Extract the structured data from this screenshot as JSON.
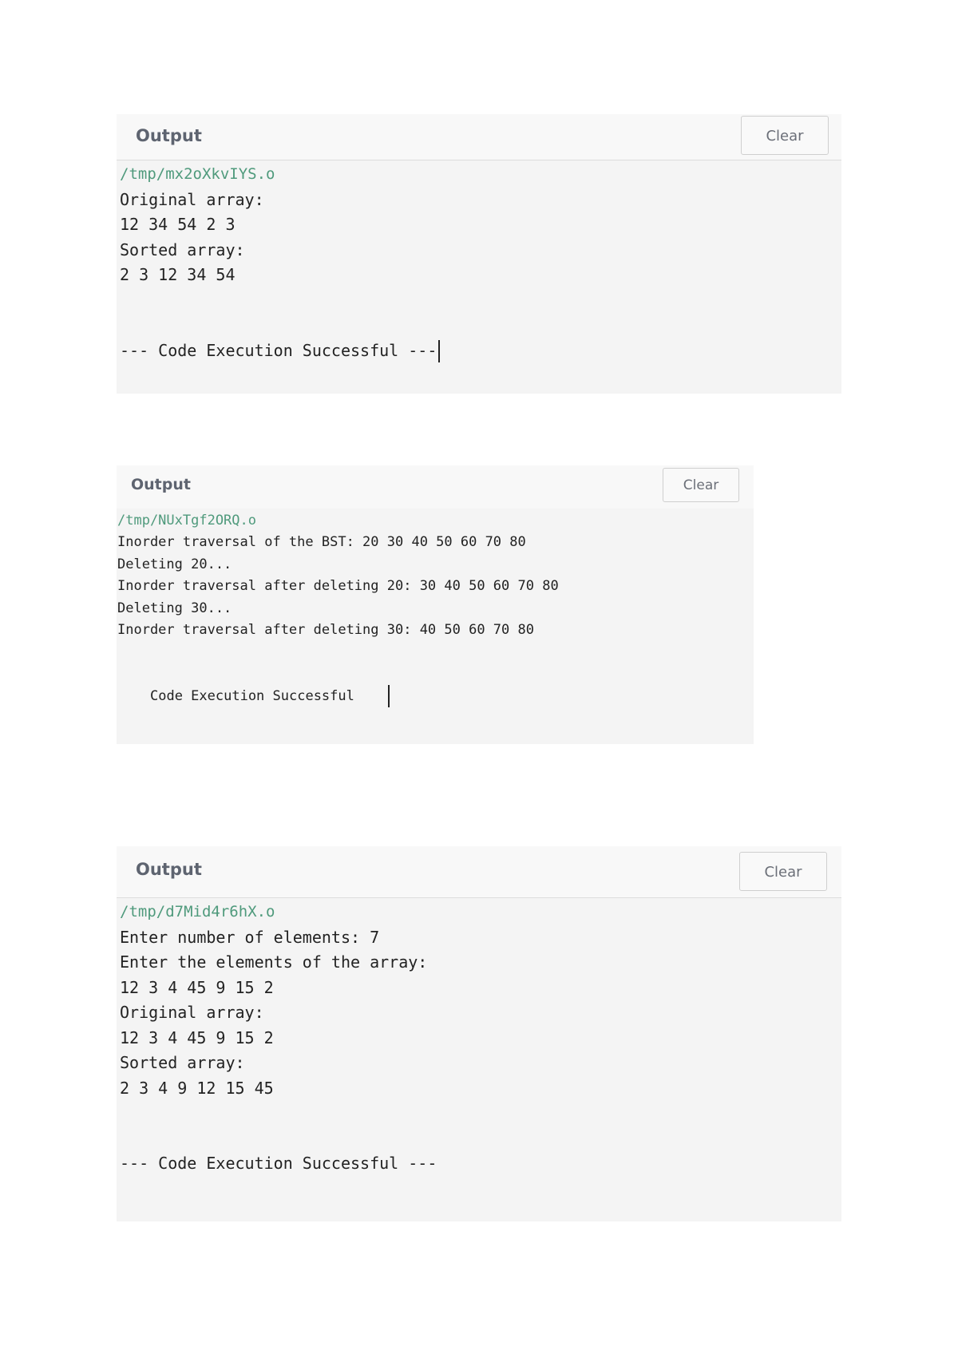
{
  "panels": [
    {
      "title": "Output",
      "clear_label": "Clear",
      "path": "/tmp/mx2oXkvIYS.o",
      "lines": [
        "Original array:",
        "12 34 54 2 3",
        "Sorted array:",
        "2 3 12 34 54"
      ],
      "success": "--- Code Execution Successful ---"
    },
    {
      "title": "Output",
      "clear_label": "Clear",
      "path": "/tmp/NUxTgf2ORQ.o",
      "lines": [
        "Inorder traversal of the BST: 20 30 40 50 60 70 80",
        "Deleting 20...",
        "Inorder traversal after deleting 20: 30 40 50 60 70 80",
        "Deleting 30...",
        "Inorder traversal after deleting 30: 40 50 60 70 80"
      ],
      "success": "Code Execution Successful"
    },
    {
      "title": "Output",
      "clear_label": "Clear",
      "path": "/tmp/d7Mid4r6hX.o",
      "lines": [
        "Enter number of elements: 7",
        "Enter the elements of the array:",
        "12 3 4 45 9 15 2",
        "Original array:",
        "12 3 4 45 9 15 2",
        "Sorted array:",
        "2 3 4 9 12 15 45"
      ],
      "success": "--- Code Execution Successful ---"
    }
  ]
}
